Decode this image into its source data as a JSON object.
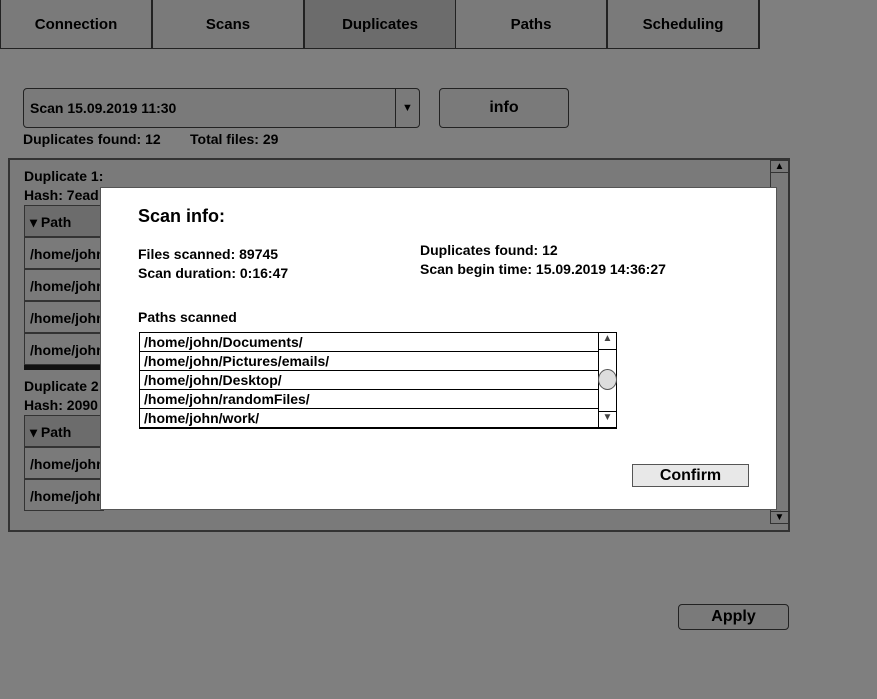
{
  "tabs": [
    "Connection",
    "Scans",
    "Duplicates",
    "Paths",
    "Scheduling"
  ],
  "selected_tab": "Duplicates",
  "scan_select": {
    "value": "Scan 15.09.2019 11:30"
  },
  "info_label": "info",
  "summary": {
    "duplicates": "Duplicates found: 12",
    "total": "Total files: 29"
  },
  "groups": [
    {
      "title": "Duplicate 1:",
      "hash": "Hash: 7ead",
      "header": "Path",
      "rows": [
        "/home/john",
        "/home/john",
        "/home/john",
        "/home/john"
      ]
    },
    {
      "title": "Duplicate 2:",
      "hash": "Hash: 2090",
      "header": "Path",
      "rows": [
        "/home/john",
        "/home/john"
      ]
    }
  ],
  "apply_label": "Apply",
  "modal": {
    "title": "Scan info:",
    "files_scanned": "Files scanned: 89745",
    "scan_duration": "Scan duration: 0:16:47",
    "duplicates_found": "Duplicates found: 12",
    "scan_begin": "Scan begin time: 15.09.2019 14:36:27",
    "paths_label": "Paths scanned",
    "paths": [
      "/home/john/Documents/",
      "/home/john/Pictures/emails/",
      "/home/john/Desktop/",
      "/home/john/randomFiles/",
      "/home/john/work/"
    ],
    "confirm_label": "Confirm"
  }
}
